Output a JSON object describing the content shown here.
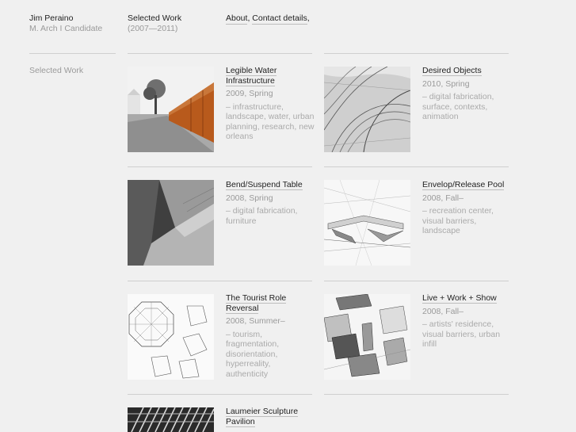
{
  "header": {
    "name": "Jim Peraino",
    "subtitle": "M. Arch I Candidate",
    "section_title": "Selected Work",
    "section_years": "(2007—2011)",
    "nav": [
      {
        "label": "About",
        "sep": ","
      },
      {
        "label": "Contact details",
        "sep": ","
      }
    ]
  },
  "sidebar": {
    "label": "Selected Work"
  },
  "projects": [
    {
      "title": "Legible Water Infrastructure",
      "date": "2009, Spring",
      "tags": "– infrastructure, landscape, water, urban planning, research, new orleans"
    },
    {
      "title": "Desired Objects",
      "date": "2010, Spring",
      "tags": "– digital fabrication, surface, contexts, animation"
    },
    {
      "title": "Bend/Suspend Table",
      "date": "2008, Spring",
      "tags": "– digital fabrication, furniture"
    },
    {
      "title": "Envelop/Release Pool",
      "date": "2008, Fall–",
      "tags": "– recreation center, visual barriers, landscape"
    },
    {
      "title": "The Tourist Role Reversal",
      "date": "2008, Summer–",
      "tags": "– tourism, fragmentation, disorientation, hyperreality, authenticity"
    },
    {
      "title": "Live + Work + Show",
      "date": "2008, Fall–",
      "tags": "– artists' residence, visual barriers, urban infill"
    },
    {
      "title": "Laumeier Sculpture Pavilion",
      "date": "",
      "tags": ""
    }
  ]
}
